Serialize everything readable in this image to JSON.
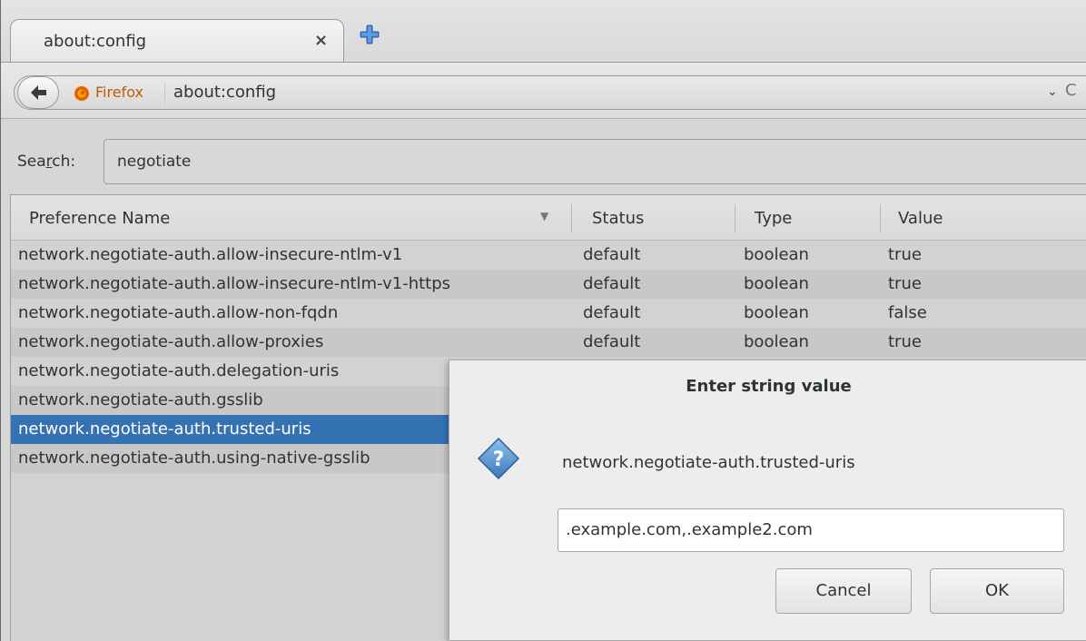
{
  "tab": {
    "title": "about:config",
    "close": "×"
  },
  "navbar": {
    "identity": "Firefox",
    "url": "about:config",
    "dropdown": "⌄",
    "reload": "C"
  },
  "search": {
    "label_pre": "Sea",
    "label_accel": "r",
    "label_post": "ch:",
    "value": "negotiate"
  },
  "table": {
    "headers": [
      "Preference Name",
      "Status",
      "Type",
      "Value"
    ],
    "rows": [
      {
        "name": "network.negotiate-auth.allow-insecure-ntlm-v1",
        "status": "default",
        "type": "boolean",
        "value": "true"
      },
      {
        "name": "network.negotiate-auth.allow-insecure-ntlm-v1-https",
        "status": "default",
        "type": "boolean",
        "value": "true"
      },
      {
        "name": "network.negotiate-auth.allow-non-fqdn",
        "status": "default",
        "type": "boolean",
        "value": "false"
      },
      {
        "name": "network.negotiate-auth.allow-proxies",
        "status": "default",
        "type": "boolean",
        "value": "true"
      },
      {
        "name": "network.negotiate-auth.delegation-uris",
        "status": "",
        "type": "",
        "value": ""
      },
      {
        "name": "network.negotiate-auth.gsslib",
        "status": "",
        "type": "",
        "value": ""
      },
      {
        "name": "network.negotiate-auth.trusted-uris",
        "status": "",
        "type": "",
        "value": ""
      },
      {
        "name": "network.negotiate-auth.using-native-gsslib",
        "status": "",
        "type": "",
        "value": ""
      }
    ],
    "selected_index": 6
  },
  "dialog": {
    "title": "Enter string value",
    "message": "network.negotiate-auth.trusted-uris",
    "input_value": ".example.com,.example2.com",
    "cancel_label": "Cancel",
    "ok_label": "OK"
  },
  "colors": {
    "selection": "#3472b4",
    "firefox_label": "#c35a00",
    "newtab_plus": "#3d7fd0"
  }
}
